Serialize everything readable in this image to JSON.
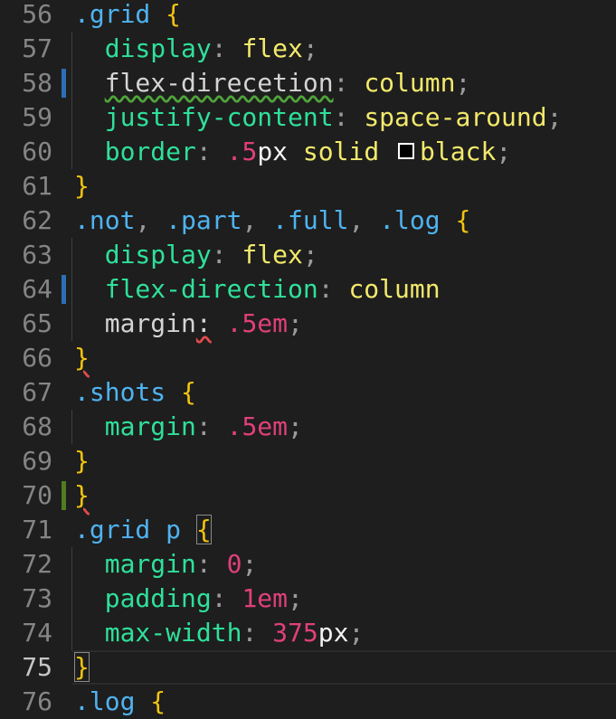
{
  "editor": {
    "lines": [
      {
        "num": "56",
        "tokens": [
          [
            ".grid",
            "sel"
          ],
          [
            " ",
            "plain"
          ],
          [
            "{",
            "brace"
          ]
        ]
      },
      {
        "num": "57",
        "tokens": [
          [
            "display",
            "prop"
          ],
          [
            ": ",
            "punc"
          ],
          [
            "flex",
            "val"
          ],
          [
            ";",
            "punc"
          ]
        ]
      },
      {
        "num": "58",
        "mark": "#2a6fb8",
        "tokens": [
          [
            "flex-direcetion",
            "plain squig-green"
          ],
          [
            ": ",
            "punc"
          ],
          [
            "column",
            "val"
          ],
          [
            ";",
            "punc"
          ]
        ]
      },
      {
        "num": "59",
        "tokens": [
          [
            "justify-content",
            "prop"
          ],
          [
            ": ",
            "punc"
          ],
          [
            "space-around",
            "val"
          ],
          [
            ";",
            "punc"
          ]
        ]
      },
      {
        "num": "60",
        "tokens": [
          [
            "border",
            "prop"
          ],
          [
            ": ",
            "punc"
          ],
          [
            ".5",
            "num"
          ],
          [
            "px",
            "unit"
          ],
          [
            " ",
            "plain"
          ],
          [
            "solid",
            "val"
          ],
          [
            " ",
            "plain"
          ],
          [
            "",
            "swatch"
          ],
          [
            "black",
            "val"
          ],
          [
            ";",
            "punc"
          ]
        ]
      },
      {
        "num": "61",
        "tokens": [
          [
            "}",
            "brace"
          ]
        ]
      },
      {
        "num": "62",
        "tokens": [
          [
            ".not",
            "sel"
          ],
          [
            ", ",
            "punc"
          ],
          [
            ".part",
            "sel"
          ],
          [
            ", ",
            "punc"
          ],
          [
            ".full",
            "sel"
          ],
          [
            ", ",
            "punc"
          ],
          [
            ".log",
            "sel"
          ],
          [
            " ",
            "plain"
          ],
          [
            "{",
            "brace"
          ]
        ]
      },
      {
        "num": "63",
        "tokens": [
          [
            "display",
            "prop"
          ],
          [
            ": ",
            "punc"
          ],
          [
            "flex",
            "val"
          ],
          [
            ";",
            "punc"
          ]
        ]
      },
      {
        "num": "64",
        "mark": "#2a6fb8",
        "tokens": [
          [
            "flex-direction",
            "prop"
          ],
          [
            ": ",
            "punc"
          ],
          [
            "column",
            "val"
          ]
        ]
      },
      {
        "num": "65",
        "tokens": [
          [
            "margin",
            "plain"
          ],
          [
            ":",
            "plain squig-red"
          ],
          [
            " ",
            "plain"
          ],
          [
            ".5em",
            "num"
          ],
          [
            ";",
            "punc"
          ]
        ]
      },
      {
        "num": "66",
        "tokens": [
          [
            "}",
            "brace squig-red"
          ]
        ]
      },
      {
        "num": "67",
        "tokens": [
          [
            ".shots",
            "sel"
          ],
          [
            " ",
            "plain"
          ],
          [
            "{",
            "brace"
          ]
        ]
      },
      {
        "num": "68",
        "tokens": [
          [
            "margin",
            "prop"
          ],
          [
            ": ",
            "punc"
          ],
          [
            ".5em",
            "num"
          ],
          [
            ";",
            "punc"
          ]
        ]
      },
      {
        "num": "69",
        "tokens": [
          [
            "}",
            "brace"
          ]
        ]
      },
      {
        "num": "70",
        "mark": "#4f7d1f",
        "tokens": [
          [
            "}",
            "brace squig-red"
          ]
        ]
      },
      {
        "num": "71",
        "tokens": [
          [
            ".grid",
            "sel"
          ],
          [
            " p",
            "sel"
          ],
          [
            " ",
            "plain"
          ],
          [
            "{",
            "brace boxed"
          ]
        ]
      },
      {
        "num": "72",
        "tokens": [
          [
            "margin",
            "prop"
          ],
          [
            ": ",
            "punc"
          ],
          [
            "0",
            "num"
          ],
          [
            ";",
            "punc"
          ]
        ]
      },
      {
        "num": "73",
        "tokens": [
          [
            "padding",
            "prop"
          ],
          [
            ": ",
            "punc"
          ],
          [
            "1em",
            "num"
          ],
          [
            ";",
            "punc"
          ]
        ]
      },
      {
        "num": "74",
        "tokens": [
          [
            "max-width",
            "prop"
          ],
          [
            ": ",
            "punc"
          ],
          [
            "375",
            "num"
          ],
          [
            "px",
            "unit"
          ],
          [
            ";",
            "punc"
          ]
        ]
      },
      {
        "num": "75",
        "active": true,
        "tokens": [
          [
            "}",
            "brace boxed"
          ]
        ]
      },
      {
        "num": "76",
        "tokens": [
          [
            ".log",
            "sel"
          ],
          [
            " ",
            "plain"
          ],
          [
            "{",
            "brace"
          ]
        ]
      }
    ]
  },
  "colors": {
    "background": "#1e1e1e",
    "selector": "#4fb3f0",
    "property": "#2fe09a",
    "value": "#f2e96b",
    "number": "#e0407a",
    "brace": "#f2c40f"
  }
}
